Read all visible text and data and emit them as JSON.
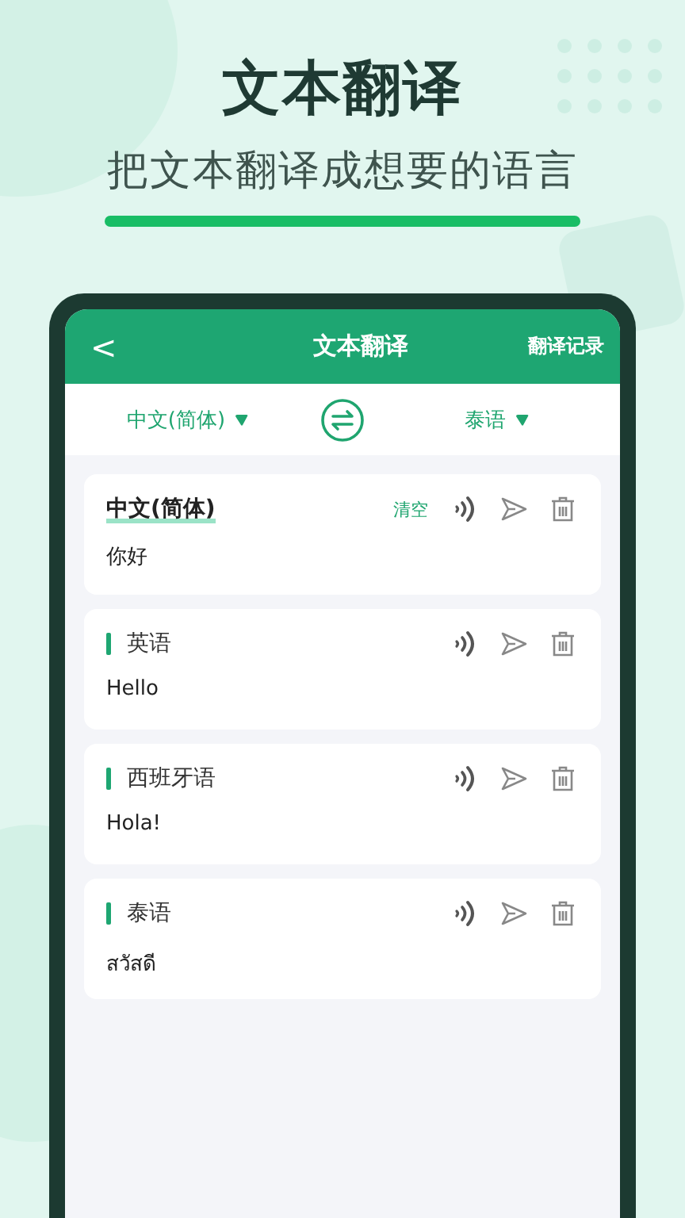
{
  "headline": "文本翻译",
  "subtitle": "把文本翻译成想要的语言",
  "app_bar": {
    "back": "<",
    "title": "文本翻译",
    "action": "翻译记录"
  },
  "language_bar": {
    "source": "中文(简体)",
    "target": "泰语"
  },
  "cards": [
    {
      "kind": "source",
      "language": "中文(简体)",
      "clear": "清空",
      "text": "你好"
    },
    {
      "kind": "target",
      "language": "英语",
      "text": "Hello"
    },
    {
      "kind": "target",
      "language": "西班牙语",
      "text": "Hola!"
    },
    {
      "kind": "target",
      "language": "泰语",
      "text": "สวัสดี"
    }
  ]
}
